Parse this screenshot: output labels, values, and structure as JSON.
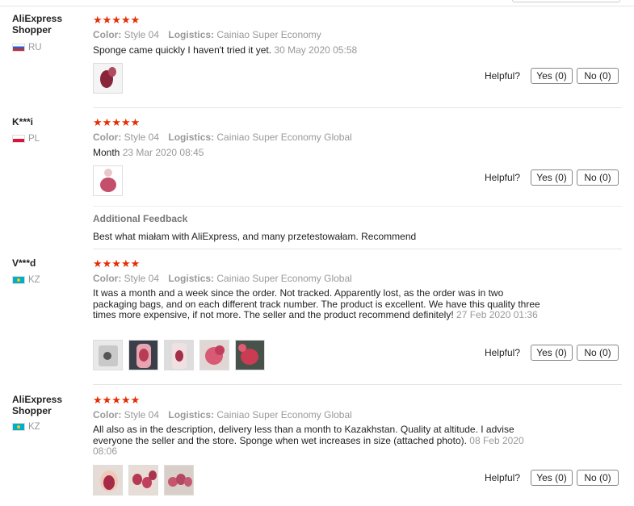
{
  "reviews": [
    {
      "name": "AliExpress Shopper",
      "country": "RU",
      "stars": "★★★★★",
      "color_label": "Color:",
      "color_value": "Style 04",
      "logistics_label": "Logistics:",
      "logistics_value": "Cainiao Super Economy",
      "text": "Sponge came quickly I haven't tried it yet.",
      "date": "30 May 2020 05:58",
      "helpful_label": "Helpful?",
      "yes": "Yes (0)",
      "no": "No (0)"
    },
    {
      "name": "K***i",
      "country": "PL",
      "stars": "★★★★★",
      "color_label": "Color:",
      "color_value": "Style 04",
      "logistics_label": "Logistics:",
      "logistics_value": "Cainiao Super Economy Global",
      "text": "Month",
      "date": "23 Mar 2020 08:45",
      "helpful_label": "Helpful?",
      "yes": "Yes (0)",
      "no": "No (0)",
      "additional_title": "Additional Feedback",
      "additional_text": "Best what miałam with AliExpress, and many przetestowałam. Recommend"
    },
    {
      "name": "V***d",
      "country": "KZ",
      "stars": "★★★★★",
      "color_label": "Color:",
      "color_value": "Style 04",
      "logistics_label": "Logistics:",
      "logistics_value": "Cainiao Super Economy Global",
      "text": "It was a month and a week since the order. Not tracked. Apparently lost, as the order was in two packaging bags, and on each different track number. The product is excellent. We have this quality three times more expensive, if not more. The seller and the product recommend definitely!",
      "date": "27 Feb 2020 01:36",
      "helpful_label": "Helpful?",
      "yes": "Yes (0)",
      "no": "No (0)"
    },
    {
      "name": "AliExpress Shopper",
      "country": "KZ",
      "stars": "★★★★★",
      "color_label": "Color:",
      "color_value": "Style 04",
      "logistics_label": "Logistics:",
      "logistics_value": "Cainiao Super Economy Global",
      "text": "All also as in the description, delivery less than a month to Kazakhstan. Quality at altitude. I advise everyone the seller and the store. Sponge when wet increases in size (attached photo).",
      "date": "08 Feb 2020 08:06",
      "helpful_label": "Helpful?",
      "yes": "Yes (0)",
      "no": "No (0)"
    }
  ],
  "colors": {
    "star": "#e62e04",
    "muted": "#999999",
    "text": "#222222"
  }
}
